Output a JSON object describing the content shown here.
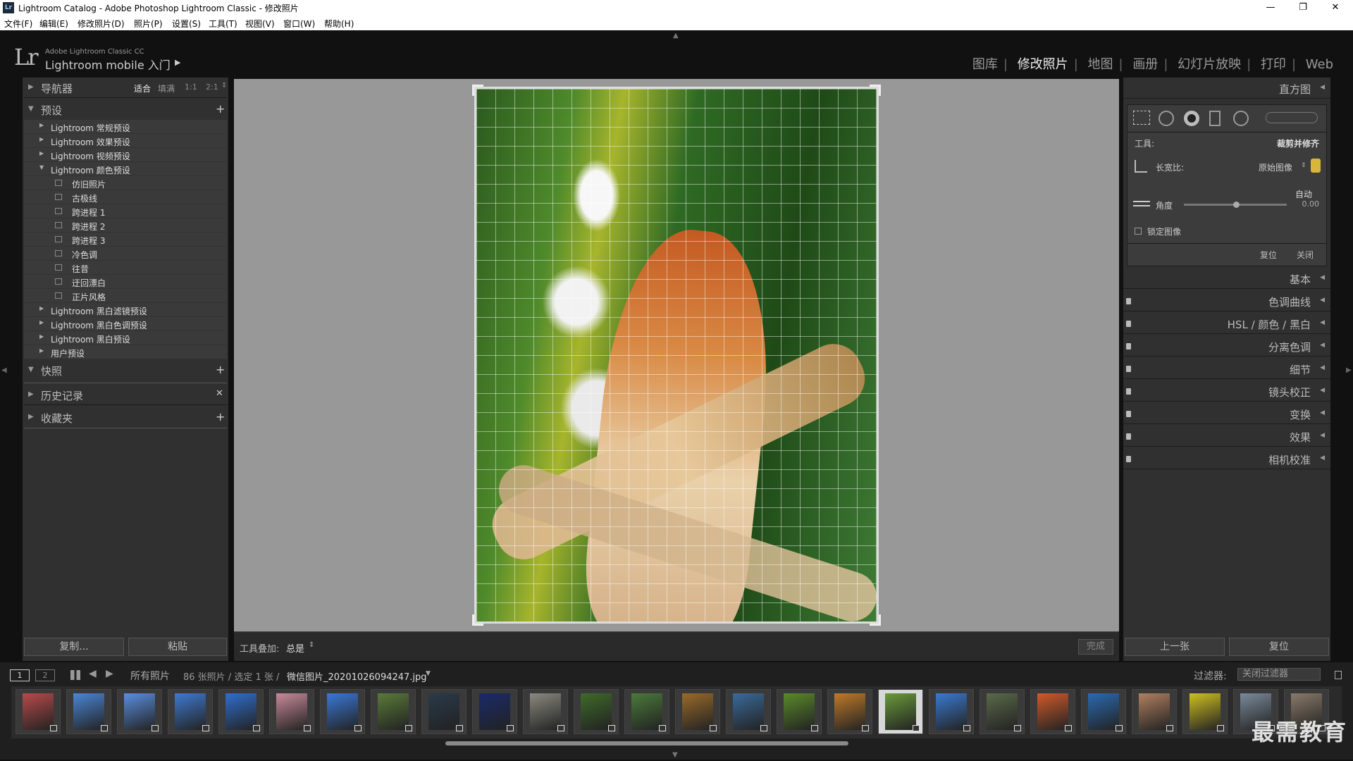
{
  "window": {
    "title": "Lightroom Catalog - Adobe Photoshop Lightroom Classic - 修改照片",
    "app_icon": "Lr"
  },
  "menu": [
    "文件(F)",
    "编辑(E)",
    "修改照片(D)",
    "照片(P)",
    "设置(S)",
    "工具(T)",
    "视图(V)",
    "窗口(W)",
    "帮助(H)"
  ],
  "identity": {
    "logo": "Lr",
    "small": "Adobe Lightroom Classic CC",
    "name": "Lightroom mobile 入门"
  },
  "modules": [
    "图库",
    "修改照片",
    "地图",
    "画册",
    "幻灯片放映",
    "打印",
    "Web"
  ],
  "active_module": "修改照片",
  "left": {
    "navigator": {
      "label": "导航器",
      "zoom": [
        "适合",
        "填满",
        "1:1",
        "2:1"
      ]
    },
    "presets": {
      "label": "预设",
      "items": [
        {
          "label": "Lightroom 常规预设",
          "level": 0,
          "open": false
        },
        {
          "label": "Lightroom 效果预设",
          "level": 0,
          "open": false
        },
        {
          "label": "Lightroom 视频预设",
          "level": 0,
          "open": false
        },
        {
          "label": "Lightroom 颜色预设",
          "level": 0,
          "open": true
        },
        {
          "label": "仿旧照片",
          "level": 1
        },
        {
          "label": "古极线",
          "level": 1
        },
        {
          "label": "跨进程 1",
          "level": 1
        },
        {
          "label": "跨进程 2",
          "level": 1
        },
        {
          "label": "跨进程 3",
          "level": 1
        },
        {
          "label": "冷色调",
          "level": 1
        },
        {
          "label": "往昔",
          "level": 1
        },
        {
          "label": "迂回漂白",
          "level": 1
        },
        {
          "label": "正片风格",
          "level": 1
        },
        {
          "label": "Lightroom 黑白滤镜预设",
          "level": 0,
          "open": false
        },
        {
          "label": "Lightroom 黑白色调预设",
          "level": 0,
          "open": false
        },
        {
          "label": "Lightroom 黑白预设",
          "level": 0,
          "open": false
        },
        {
          "label": "用户预设",
          "level": 0,
          "open": false
        }
      ]
    },
    "snapshots": "快照",
    "history": "历史记录",
    "collections": "收藏夹",
    "copy_btn": "复制...",
    "paste_btn": "粘贴"
  },
  "toolbar": {
    "overlay_label": "工具叠加:",
    "overlay_value": "总是",
    "done": "完成"
  },
  "right": {
    "histogram": "直方图",
    "crop": {
      "tool_label": "工具:",
      "tool_value": "裁剪并修齐",
      "aspect_label": "长宽比:",
      "aspect_value": "原始图像",
      "auto": "自动",
      "angle_label": "角度",
      "angle_value": "0.00",
      "constrain": "锁定图像",
      "reset": "复位",
      "close": "关闭"
    },
    "panels": [
      "基本",
      "色调曲线",
      "HSL / 颜色 / 黑白",
      "分离色调",
      "细节",
      "镜头校正",
      "变换",
      "效果",
      "相机校准"
    ],
    "prev_btn": "上一张",
    "reset_btn": "复位"
  },
  "filmstrip": {
    "views": [
      "1",
      "2"
    ],
    "source": "所有照片",
    "info": "86 张照片 / 选定 1 张 /",
    "filename": "微信图片_20201026094247.jpg",
    "filter_label": "过滤器:",
    "filter_value": "关闭过滤器",
    "selected_index": 17,
    "thumbs": [
      "#b84a4a",
      "#4a86d6",
      "#5a8ee0",
      "#3f7ad0",
      "#2f6fcf",
      "#c88a9a",
      "#3a78d8",
      "#5a7a3a",
      "#2a3a4a",
      "#1a2a6a",
      "#8a8a80",
      "#3f6a2a",
      "#4a7a3a",
      "#9a6a2a",
      "#3a6a9a",
      "#5a8a2a",
      "#c07a2a",
      "#6a9a3a",
      "#3a7ad0",
      "#5a6a4a",
      "#d05a2a",
      "#2a6ab0",
      "#b08060",
      "#d0c020",
      "#7a8a9a",
      "#8a7a6a"
    ]
  },
  "watermark": "最需教育"
}
